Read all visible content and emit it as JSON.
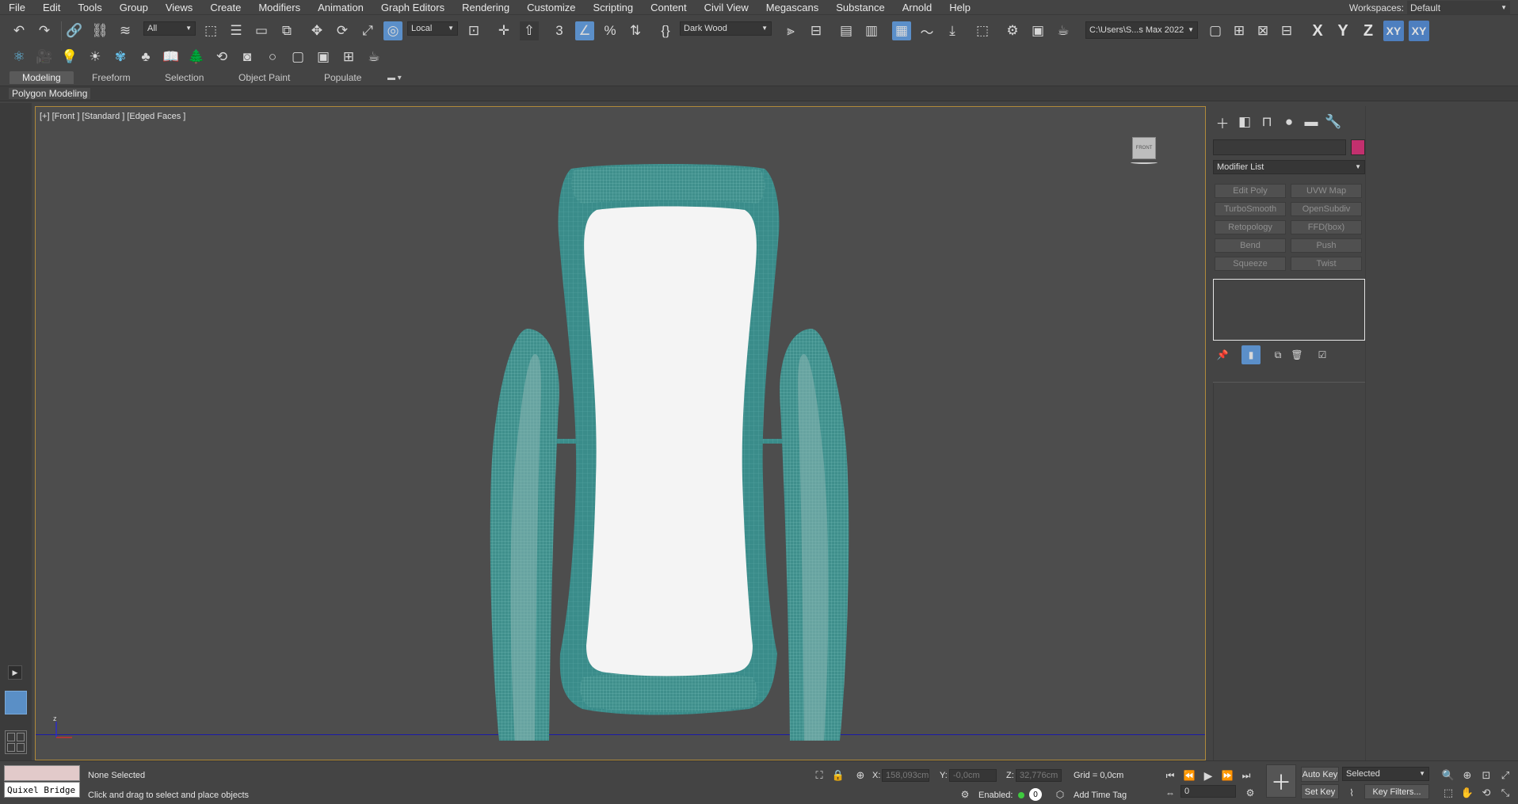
{
  "menu": {
    "items": [
      "File",
      "Edit",
      "Tools",
      "Group",
      "Views",
      "Create",
      "Modifiers",
      "Animation",
      "Graph Editors",
      "Rendering",
      "Customize",
      "Scripting",
      "Content",
      "Civil View",
      "Megascans",
      "Substance",
      "Arnold",
      "Help"
    ],
    "workspaces_label": "Workspaces:",
    "workspace_value": "Default"
  },
  "toolbar": {
    "selection_filter": "All",
    "reference_coord": "Local",
    "named_selection": "Dark Wood",
    "project_path": "C:\\Users\\S...s Max 2022",
    "axis_x": "X",
    "axis_y": "Y",
    "axis_z": "Z",
    "axis_xy": "XY",
    "axis_xy2": "XY"
  },
  "ribbon": {
    "tabs": [
      "Modeling",
      "Freeform",
      "Selection",
      "Object Paint",
      "Populate"
    ],
    "panel_label": "Polygon Modeling"
  },
  "viewport": {
    "label": "[+] [Front ] [Standard ] [Edged Faces ]",
    "viewcube_label": "FRONT",
    "colors": {
      "wire": "#3a8c8a",
      "mirror": "#f4f4f4",
      "background": "#4d4d4d"
    }
  },
  "command_panel": {
    "object_color": "#c2306e",
    "modifier_list": "Modifier List",
    "modifier_buttons": [
      "Edit Poly",
      "UVW Map",
      "TurboSmooth",
      "OpenSubdiv",
      "Retopology",
      "FFD(box)",
      "Bend",
      "Push",
      "Squeeze",
      "Twist"
    ]
  },
  "status": {
    "maxscript": "Quixel Bridge",
    "selection": "None Selected",
    "prompt": "Click and drag to select and place objects",
    "x_label": "X:",
    "x_value": "158,093cm",
    "y_label": "Y:",
    "y_value": "-0,0cm",
    "z_label": "Z:",
    "z_value": "32,776cm",
    "grid": "Grid = 0,0cm",
    "enabled_label": "Enabled:",
    "enabled_count": "0",
    "time_tag": "Add Time Tag",
    "auto_key": "Auto Key",
    "set_key": "Set Key",
    "key_mode": "Selected",
    "frame": "0",
    "key_filters": "Key Filters..."
  }
}
